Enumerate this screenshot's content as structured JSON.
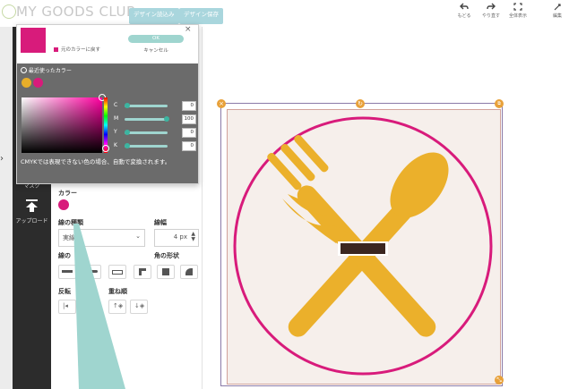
{
  "header": {
    "brand": "MY GOODS CLUB",
    "tabs": [
      "デザイン読込み",
      "デザイン保存"
    ],
    "tools": [
      {
        "label": "もどる",
        "icon": "undo-icon"
      },
      {
        "label": "やり直す",
        "icon": "redo-icon"
      },
      {
        "label": "全体表示",
        "icon": "fit-screen-icon"
      },
      {
        "label": "編集",
        "icon": "edit-icon"
      }
    ]
  },
  "left_toolbar": {
    "items": [
      {
        "label": "マスク",
        "icon": "mask-icon"
      },
      {
        "label": "アップロード",
        "icon": "upload-icon"
      }
    ]
  },
  "color_picker": {
    "reset_label": "元のカラーに戻す",
    "ok_label": "OK",
    "cancel_label": "キャンセル",
    "recent_label": "最近使ったカラー",
    "current_color": "#d81b7b",
    "recent_colors": [
      "#e8ae2a",
      "#d81b7b"
    ],
    "channels": [
      {
        "name": "C",
        "value": "0",
        "fraction": 0.0
      },
      {
        "name": "M",
        "value": "100",
        "fraction": 1.0
      },
      {
        "name": "Y",
        "value": "0",
        "fraction": 0.0
      },
      {
        "name": "K",
        "value": "0",
        "fraction": 0.0
      }
    ],
    "note": "CMYKでは表現できない色の場合、自動で変換されます。"
  },
  "properties": {
    "color_label": "カラー",
    "color_value": "#d81b7b",
    "line_type_label": "線の種類",
    "line_type_value": "実線",
    "line_width_label": "線幅",
    "line_width_value": "4 px",
    "line_end_label": "線の",
    "corner_label": "角の形状",
    "flip_label": "反転",
    "order_label": "重ね順"
  },
  "colors": {
    "accent_teal": "#9fd5cf",
    "design_pink": "#d81b7b",
    "design_gold": "#ebb02b",
    "label_dark": "#3b2620",
    "handle_orange": "#e8a13a"
  }
}
